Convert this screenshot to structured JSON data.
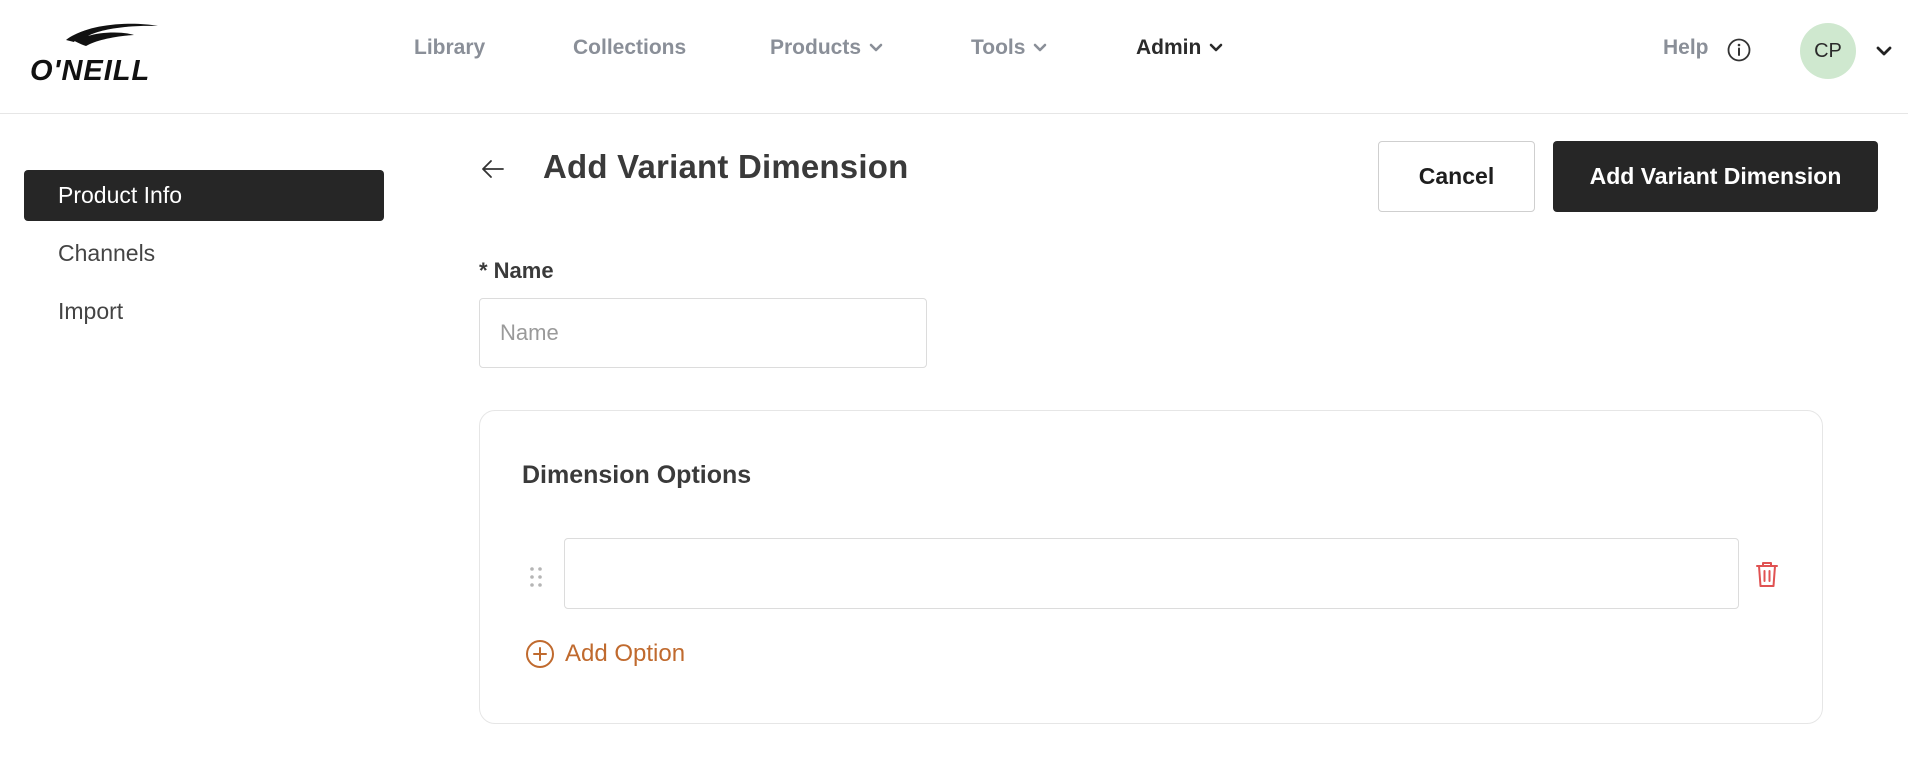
{
  "header": {
    "logo_alt": "O'NEILL",
    "nav": [
      {
        "label": "Library",
        "has_dropdown": false,
        "active": false
      },
      {
        "label": "Collections",
        "has_dropdown": false,
        "active": false
      },
      {
        "label": "Products",
        "has_dropdown": true,
        "active": false
      },
      {
        "label": "Tools",
        "has_dropdown": true,
        "active": false
      },
      {
        "label": "Admin",
        "has_dropdown": true,
        "active": true
      }
    ],
    "help_label": "Help",
    "avatar_initials": "CP"
  },
  "sidebar": {
    "items": [
      {
        "label": "Product Info",
        "active": true
      },
      {
        "label": "Channels",
        "active": false
      },
      {
        "label": "Import",
        "active": false
      }
    ]
  },
  "page": {
    "title": "Add Variant Dimension",
    "cancel_label": "Cancel",
    "submit_label": "Add Variant Dimension"
  },
  "form": {
    "name_label": "* Name",
    "name_placeholder": "Name",
    "name_value": ""
  },
  "options": {
    "title": "Dimension Options",
    "items": [
      ""
    ],
    "add_label": "Add Option"
  },
  "colors": {
    "primary": "#262626",
    "accent": "#c06a2e",
    "danger": "#e05252",
    "avatar_bg": "#cfe8cf",
    "nav_muted": "#8a8f98"
  }
}
